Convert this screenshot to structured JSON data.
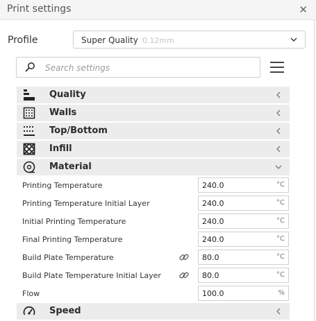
{
  "window": {
    "title": "Print settings"
  },
  "profile": {
    "label": "Profile",
    "name": "Super Quality",
    "layer": "0.12mm"
  },
  "search": {
    "placeholder": "Search settings"
  },
  "icons": {
    "close": "close-icon",
    "menu": "hamburger-menu-icon",
    "search": "search-icon",
    "link": "link-icon"
  },
  "categories": [
    {
      "label": "Quality",
      "icon": "quality-icon",
      "expanded": false
    },
    {
      "label": "Walls",
      "icon": "walls-icon",
      "expanded": false
    },
    {
      "label": "Top/Bottom",
      "icon": "top-bottom-icon",
      "expanded": false
    },
    {
      "label": "Infill",
      "icon": "infill-icon",
      "expanded": false
    },
    {
      "label": "Material",
      "icon": "material-icon",
      "expanded": true
    }
  ],
  "settings": [
    {
      "label": "Printing Temperature",
      "value": "240.0",
      "unit": "°C",
      "linked": false
    },
    {
      "label": "Printing Temperature Initial Layer",
      "value": "240.0",
      "unit": "°C",
      "linked": false
    },
    {
      "label": "Initial Printing Temperature",
      "value": "240.0",
      "unit": "°C",
      "linked": false
    },
    {
      "label": "Final Printing Temperature",
      "value": "240.0",
      "unit": "°C",
      "linked": false
    },
    {
      "label": "Build Plate Temperature",
      "value": "80.0",
      "unit": "°C",
      "linked": true
    },
    {
      "label": "Build Plate Temperature Initial Layer",
      "value": "80.0",
      "unit": "°C",
      "linked": true
    },
    {
      "label": "Flow",
      "value": "100.0",
      "unit": "%",
      "linked": false
    }
  ],
  "speed": {
    "label": "Speed",
    "icon": "speed-icon",
    "expanded": false
  },
  "colors": {
    "category_bg": "#ececec",
    "border": "#cfcfcf",
    "muted_text": "#c3c3c3"
  }
}
